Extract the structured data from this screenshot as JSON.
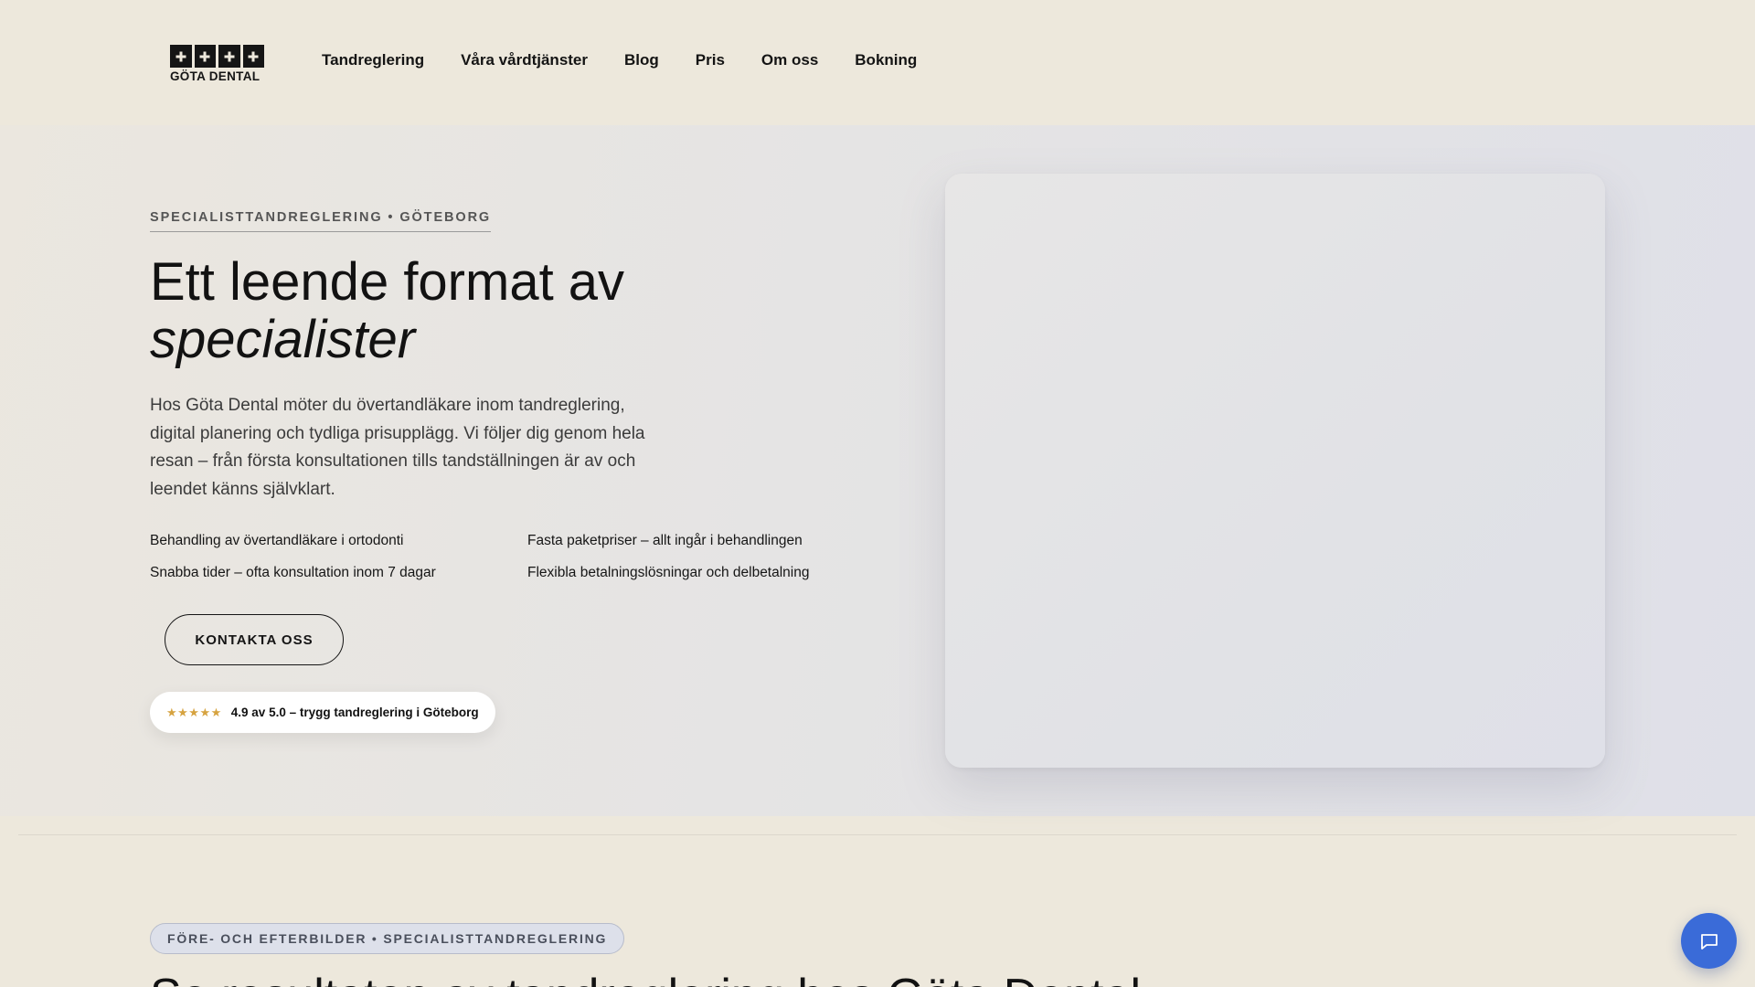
{
  "header": {
    "logo_text": "GÖTA DENTAL",
    "nav": [
      "Tandreglering",
      "Våra vårdtjänster",
      "Blog",
      "Pris",
      "Om oss",
      "Bokning"
    ]
  },
  "hero": {
    "eyebrow": "SPECIALISTTANDREGLERING • GÖTEBORG",
    "title_line1": "Ett leende format av",
    "title_line2": "specialister",
    "description": "Hos Göta Dental möter du övertandläkare inom tandreglering, digital planering och tydliga prisupplägg. Vi följer dig genom hela resan – från första konsultationen tills tandställningen är av och leendet känns självklart.",
    "features": [
      "Behandling av övertandläkare i ortodonti",
      "Fasta paketpriser – allt ingår i behandlingen",
      "Snabba tider – ofta konsultation inom 7 dagar",
      "Flexibla betalningslösningar och delbetalning"
    ],
    "cta_label": "KONTAKTA OSS",
    "rating": {
      "stars": "★★★★★",
      "text": "4.9 av 5.0 – trygg tandreglering i Göteborg"
    }
  },
  "next_section": {
    "pill": "FÖRE- OCH EFTERBILDER • SPECIALISTTANDREGLERING",
    "heading": "Se resultaten av tandreglering hos Göta Dental"
  },
  "colors": {
    "background": "#ede8dc",
    "accent_blue": "#3a6bd8",
    "star_gold": "#d6a340",
    "text_dark": "#141414"
  },
  "icons": {
    "chat": "chat-bubble-icon",
    "logo": "tooth-blocks-logo-icon"
  }
}
